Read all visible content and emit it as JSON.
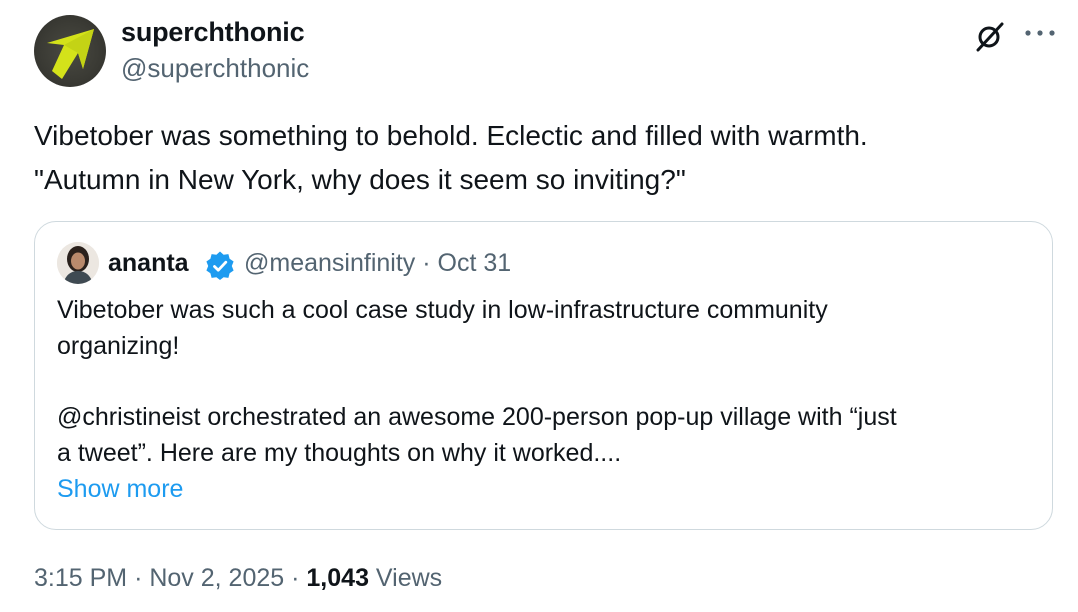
{
  "author": {
    "display_name": "superchthonic",
    "handle": "@superchthonic"
  },
  "tweet": {
    "lines": [
      "Vibetober was something to behold. Eclectic and filled with warmth.",
      "\"Autumn in New York, why does it seem so inviting?\""
    ]
  },
  "quoted_tweet": {
    "display_name": "ananta",
    "handle": "@meansinfinity",
    "separator": "·",
    "date": "Oct 31",
    "lines": [
      "Vibetober was such a cool case study in low-infrastructure community",
      "organizing!",
      "@christineist orchestrated an awesome 200-person pop-up village with “just",
      "a tweet”. Here are my thoughts on why it worked...."
    ],
    "show_more": "Show more"
  },
  "footer": {
    "time": "3:15 PM",
    "separator": "·",
    "date": "Nov 2, 2025",
    "views_count": "1,043",
    "views_label": "Views"
  },
  "icons": {
    "avatar": "yellow-arrow-logo",
    "grok": "grok-icon",
    "more": "more-icon",
    "verified": "verified-badge-icon"
  },
  "colors": {
    "accent": "#1d9bf0",
    "secondary_text": "#536471",
    "avatar_arrow": "#d4e21a"
  }
}
